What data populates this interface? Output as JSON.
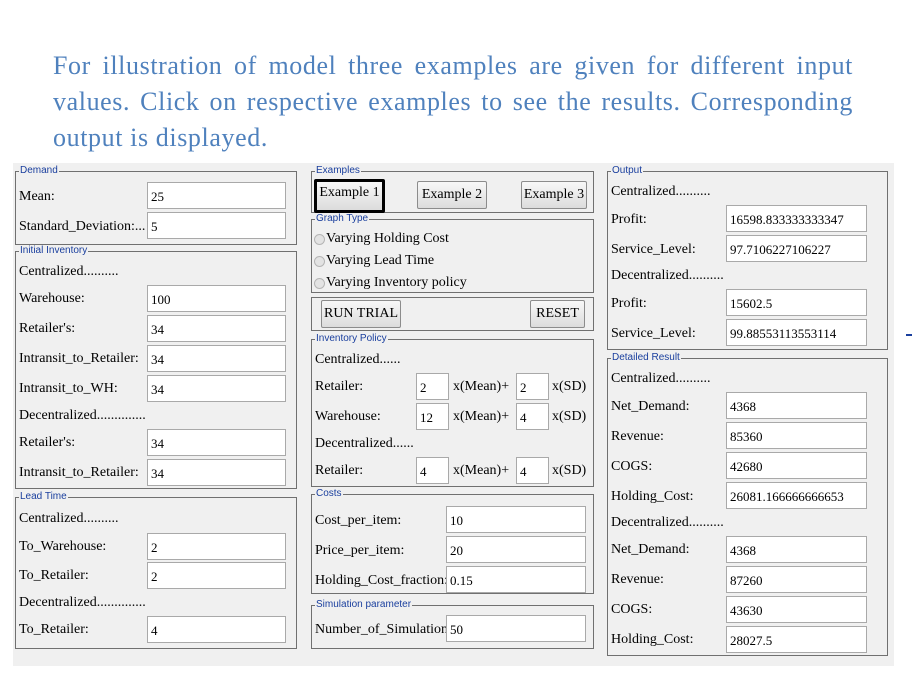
{
  "heading": "For illustration of model three examples are given for different input values. Click on respective examples to see the results. Corresponding output is displayed.",
  "demand": {
    "legend": "Demand",
    "mean_label": "Mean:",
    "mean_value": "25",
    "sd_label": "Standard_Deviation:...",
    "sd_value": "5"
  },
  "initial_inventory": {
    "legend": "Initial Inventory",
    "centralized_label": "Centralized..........",
    "warehouse_label": "Warehouse:",
    "warehouse_value": "100",
    "retailers_label": "Retailer's:",
    "retailers_value": "34",
    "intransit_retailer_label": "Intransit_to_Retailer:",
    "intransit_retailer_value": "34",
    "intransit_wh_label": "Intransit_to_WH:",
    "intransit_wh_value": "34",
    "decentralized_label": "Decentralized..............",
    "d_retailers_label": "Retailer's:",
    "d_retailers_value": "34",
    "d_intransit_retailer_label": "Intransit_to_Retailer:",
    "d_intransit_retailer_value": "34"
  },
  "lead_time": {
    "legend": "Lead Time",
    "centralized_label": "Centralized..........",
    "to_warehouse_label": "To_Warehouse:",
    "to_warehouse_value": "2",
    "to_retailer_label": "To_Retailer:",
    "to_retailer_value": "2",
    "decentralized_label": "Decentralized..............",
    "d_to_retailer_label": "To_Retailer:",
    "d_to_retailer_value": "4"
  },
  "examples": {
    "legend": "Examples",
    "example1": "Example 1",
    "example2": "Example 2",
    "example3": "Example 3"
  },
  "graph_type": {
    "legend": "Graph Type",
    "opt1": "Varying Holding Cost",
    "opt2": "Varying Lead Time",
    "opt3": "Varying Inventory policy"
  },
  "actions": {
    "run_trial": "RUN TRIAL",
    "reset": "RESET"
  },
  "inventory_policy": {
    "legend": "Inventory Policy",
    "centralized_label": "Centralized......",
    "retailer_label": "Retailer:",
    "retailer_mean": "2",
    "retailer_sd": "2",
    "warehouse_label": "Warehouse:",
    "warehouse_mean": "12",
    "warehouse_sd": "4",
    "decentralized_label": "Decentralized......",
    "d_retailer_label": "Retailer:",
    "d_retailer_mean": "4",
    "d_retailer_sd": "4",
    "mean_suffix": "x(Mean)+",
    "sd_suffix": "x(SD)"
  },
  "costs": {
    "legend": "Costs",
    "cost_label": "Cost_per_item:",
    "cost_value": "10",
    "price_label": "Price_per_item:",
    "price_value": "20",
    "holding_label": "Holding_Cost_fraction:.",
    "holding_value": "0.15"
  },
  "simulation": {
    "legend": "Simulation parameter",
    "num_label": "Number_of_Simulation:",
    "num_value": "50"
  },
  "output": {
    "legend": "Output",
    "centralized_label": "Centralized..........",
    "profit_label": "Profit:",
    "profit_value": "16598.833333333347",
    "service_label": "Service_Level:",
    "service_value": "97.7106227106227",
    "decentralized_label": "Decentralized..........",
    "d_profit_label": "Profit:",
    "d_profit_value": "15602.5",
    "d_service_label": "Service_Level:",
    "d_service_value": "99.88553113553114"
  },
  "detailed": {
    "legend": "Detailed Result",
    "centralized_label": "Centralized..........",
    "net_demand_label": "Net_Demand:",
    "net_demand_value": "4368",
    "revenue_label": "Revenue:",
    "revenue_value": "85360",
    "cogs_label": "COGS:",
    "cogs_value": "42680",
    "holding_label": "Holding_Cost:",
    "holding_value": "26081.166666666653",
    "decentralized_label": "Decentralized..........",
    "d_net_demand_label": "Net_Demand:",
    "d_net_demand_value": "4368",
    "d_revenue_label": "Revenue:",
    "d_revenue_value": "87260",
    "d_cogs_label": "COGS:",
    "d_cogs_value": "43630",
    "d_holding_label": "Holding_Cost:",
    "d_holding_value": "28027.5"
  },
  "colors": {
    "heading": "#4f81bd",
    "legend": "#1a3f9e",
    "panel": "#f0f0f0"
  }
}
